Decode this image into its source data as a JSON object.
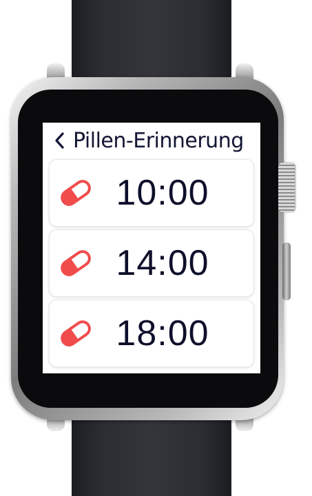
{
  "app": {
    "title": "Pillen-Erinnerung",
    "back_icon": "chevron-left-icon"
  },
  "reminders": [
    {
      "time": "10:00",
      "icon": "pill-icon"
    },
    {
      "time": "14:00",
      "icon": "pill-icon"
    },
    {
      "time": "18:00",
      "icon": "pill-icon"
    }
  ],
  "colors": {
    "pill": "#f04c4c",
    "title_text": "#121533",
    "time_text": "#0e0f2a",
    "background": "#ffffff"
  }
}
